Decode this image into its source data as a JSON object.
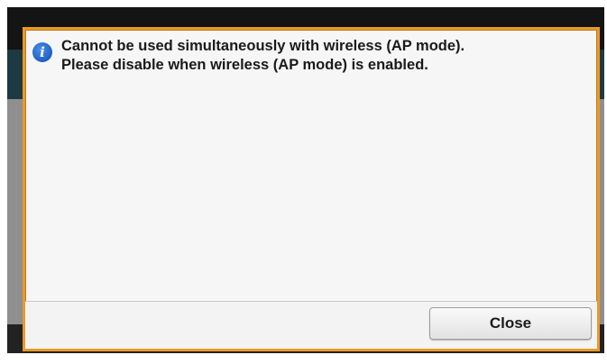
{
  "dialog": {
    "icon": "info-icon",
    "icon_glyph": "i",
    "message_lines": [
      "Cannot be used simultaneously with wireless (AP mode).",
      "Please disable when wireless (AP mode) is enabled."
    ],
    "close_label": "Close",
    "border_color": "#e89a2a",
    "icon_color": "#1f5fc4"
  }
}
